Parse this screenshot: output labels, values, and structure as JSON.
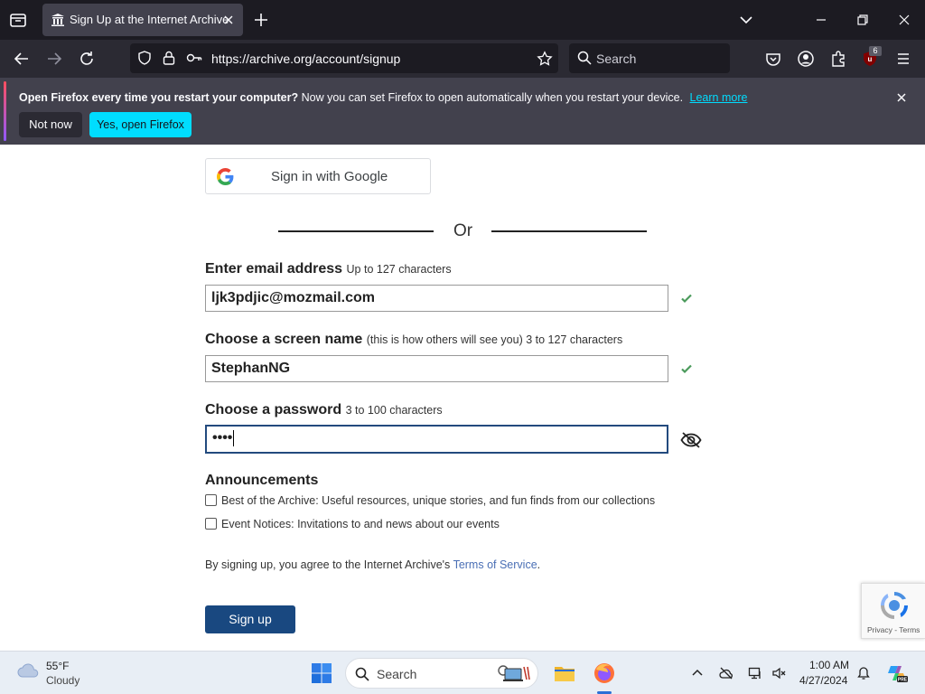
{
  "browser": {
    "tab_title": "Sign Up at the Internet Archive",
    "url": "https://archive.org/account/signup",
    "search_placeholder": "Search",
    "extension_badge": "6"
  },
  "notification": {
    "bold_text": "Open Firefox every time you restart your computer?",
    "text": "Now you can set Firefox to open automatically when you restart your device.",
    "link": "Learn more",
    "not_now": "Not now",
    "yes_open": "Yes, open Firefox"
  },
  "form": {
    "google_button": "Sign in with Google",
    "or_text": "Or",
    "email_label": "Enter email address",
    "email_hint": "Up to 127 characters",
    "email_value": "ljk3pdjic@mozmail.com",
    "screen_name_label": "Choose a screen name",
    "screen_name_hint": "(this is how others will see you) 3 to 127 characters",
    "screen_name_value": "StephanNG",
    "password_label": "Choose a password",
    "password_hint": "3 to 100 characters",
    "password_value": "••••",
    "announcements_heading": "Announcements",
    "announcement_1": "Best of the Archive: Useful resources, unique stories, and fun finds from our collections",
    "announcement_2": "Event Notices: Invitations to and news about our events",
    "terms_prefix": "By signing up, you agree to the Internet Archive's",
    "terms_link": "Terms of Service",
    "terms_suffix": ".",
    "signup_button": "Sign up"
  },
  "recaptcha": {
    "links": "Privacy - Terms"
  },
  "taskbar": {
    "temperature": "55°F",
    "weather": "Cloudy",
    "search_placeholder": "Search",
    "time": "1:00 AM",
    "date": "4/27/2024"
  },
  "colors": {
    "accent_dark_blue": "#194880",
    "check_green": "#4a9a5b",
    "notice_button_cyan": "#00ddff",
    "link_blue": "#4a6fb5"
  }
}
